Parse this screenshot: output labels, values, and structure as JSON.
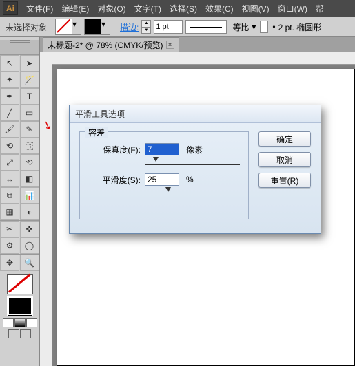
{
  "app": {
    "logo": "Ai"
  },
  "menu": {
    "file": "文件(F)",
    "edit": "编辑(E)",
    "object": "对象(O)",
    "type": "文字(T)",
    "select": "选择(S)",
    "effect": "效果(C)",
    "view": "视图(V)",
    "window": "窗口(W)",
    "help": "帮"
  },
  "controlbar": {
    "no_selection": "未选择对象",
    "stroke_label": "描边:",
    "stroke_weight": "1 pt",
    "proportion": "等比",
    "pt_label": "2 pt. 椭圆形"
  },
  "doc": {
    "tab": "未标题-2* @ 78%  (CMYK/预览)",
    "close": "×"
  },
  "dialog": {
    "title": "平滑工具选项",
    "group_label": "容差",
    "fidelity_label": "保真度(F):",
    "fidelity_value": "7",
    "fidelity_unit": "像素",
    "smoothness_label": "平滑度(S):",
    "smoothness_value": "25",
    "smoothness_unit": "%",
    "ok": "确定",
    "cancel": "取消",
    "reset": "重置(R)"
  },
  "tools": {
    "t1": "↖",
    "t2": "➤",
    "t3": "✦",
    "t4": "🪄",
    "t5": "✒",
    "t6": "T",
    "t7": "╱",
    "t8": "▭",
    "t9": "🖌",
    "t10": "✎",
    "t11": "⟲",
    "t12": "⿹",
    "t13": "⤢",
    "t14": "⟲",
    "t15": "↔",
    "t16": "◧",
    "t17": "⧉",
    "t18": "📊",
    "t19": "▦",
    "t20": "◐",
    "t21": "✂",
    "t22": "✜",
    "t23": "⚙",
    "t24": "◯",
    "t25": "✥",
    "t26": "🔍"
  }
}
